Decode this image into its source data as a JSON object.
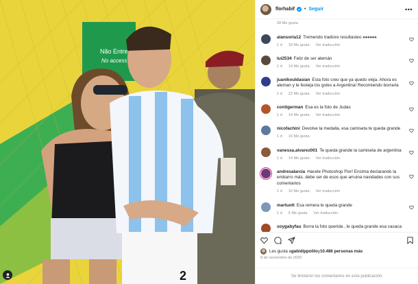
{
  "header": {
    "username": "florhabif",
    "separator": "•",
    "follow_label": "Seguir",
    "more_label": "•••"
  },
  "top_meta": {
    "likes": "28 Me gusta"
  },
  "comments": [
    {
      "user": "alansoria12",
      "text": "Tremendo tradiore resultasteo",
      "time": "1 d",
      "likes": "18 Me gusta",
      "reply": "Ver traducción",
      "avatar_color": "#3b4a5a"
    },
    {
      "user": "lui2534",
      "text": "Feliz de ser alemán",
      "time": "1 d",
      "likes": "14 Me gusta",
      "reply": "Ver traducción",
      "avatar_color": "#5a4a3a"
    },
    {
      "user": "juanikouldasian",
      "text": "Esta foto creo que ya quedo vieja. Ahora es aleman y le festeja los goles a Argentina! Recomiendo borrarla",
      "time": "1 d",
      "likes": "22 Me gusta",
      "reply": "Ver traducción",
      "avatar_color": "#2f3e8a"
    },
    {
      "user": "contigerman",
      "text": "Esa es la foto de Judas",
      "time": "1 d",
      "likes": "14 Me gusta",
      "reply": "Ver traducción",
      "avatar_color": "#b5542c"
    },
    {
      "user": "nicofachini",
      "text": "Devolve la medalla, esa camiseta te queda grande",
      "time": "1 d",
      "likes": "16 Me gusta",
      "reply": "",
      "avatar_color": "#5e7a9a"
    },
    {
      "user": "vanessa.alvarez001",
      "text": "Te queda grande la camiseta de argentina",
      "time": "1 d",
      "likes": "14 Me gusta",
      "reply": "Ver traducción",
      "avatar_color": "#8a5a3a"
    },
    {
      "user": "andresalarcia",
      "text": "Hacele Photoshop Flor! Encima declarando la embarro más. debe ser de esos que arruina navidades con sus comentarios",
      "time": "1 d",
      "likes": "10 Me gusta",
      "reply": "Ver traducción",
      "avatar_color": "#6a3a7a"
    },
    {
      "user": "martuott",
      "text": "Esa remera le queda grande",
      "time": "1 d",
      "likes": "5 Me gusta",
      "reply": "Ver traducción",
      "avatar_color": "#7a98b8"
    },
    {
      "user": "soygabyfau",
      "text": "Borra la foto querida , le queda grande esa casaca",
      "time": "",
      "likes": "",
      "reply": "",
      "avatar_color": "#a04a2a"
    }
  ],
  "likes_line": {
    "prefix": "Les gusta a ",
    "user": "gabidippolito",
    "middle": " y ",
    "count": "10.486 personas más"
  },
  "date": "8 de noviembre de 2020",
  "footer": "Se limitaron los comentarios en esta publicación.",
  "photo": {
    "sign_line1": "Não Entre",
    "sign_line2": "No access"
  },
  "colors": {
    "accent": "#0095f6",
    "text": "#262626",
    "muted": "#8e8e8e",
    "heart_stroke": "#262626"
  }
}
